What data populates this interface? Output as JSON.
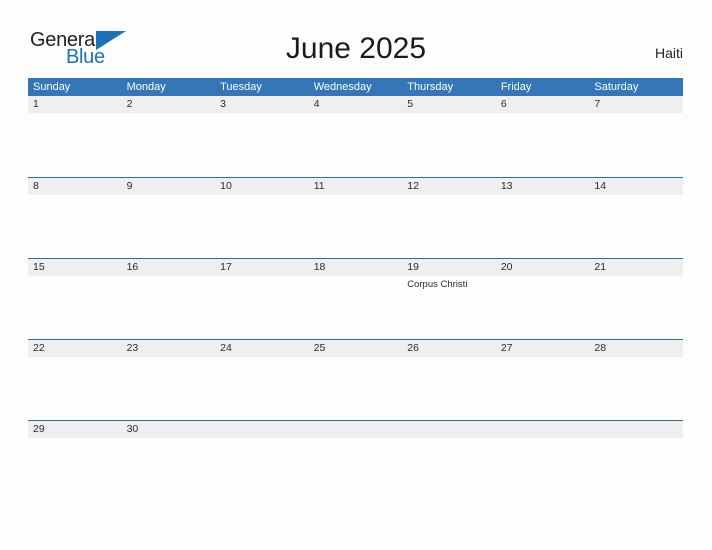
{
  "header": {
    "logo": {
      "general": "General",
      "blue": "Blue",
      "flag_icon": "triangle-flag-icon"
    },
    "title": "June 2025",
    "country": "Haiti"
  },
  "colors": {
    "header_blue": "#3576b9",
    "row_border_blue": "#2a6db3",
    "date_band_gray": "#efefef",
    "logo_blue": "#1c72b8",
    "page_background": "#fdfdfd",
    "text_dark": "#2b2b2b"
  },
  "calendar": {
    "weekdays": [
      "Sunday",
      "Monday",
      "Tuesday",
      "Wednesday",
      "Thursday",
      "Friday",
      "Saturday"
    ],
    "weeks": [
      [
        {
          "date": "1",
          "events": []
        },
        {
          "date": "2",
          "events": []
        },
        {
          "date": "3",
          "events": []
        },
        {
          "date": "4",
          "events": []
        },
        {
          "date": "5",
          "events": []
        },
        {
          "date": "6",
          "events": []
        },
        {
          "date": "7",
          "events": []
        }
      ],
      [
        {
          "date": "8",
          "events": []
        },
        {
          "date": "9",
          "events": []
        },
        {
          "date": "10",
          "events": []
        },
        {
          "date": "11",
          "events": []
        },
        {
          "date": "12",
          "events": []
        },
        {
          "date": "13",
          "events": []
        },
        {
          "date": "14",
          "events": []
        }
      ],
      [
        {
          "date": "15",
          "events": []
        },
        {
          "date": "16",
          "events": []
        },
        {
          "date": "17",
          "events": []
        },
        {
          "date": "18",
          "events": []
        },
        {
          "date": "19",
          "events": [
            "Corpus Christi"
          ]
        },
        {
          "date": "20",
          "events": []
        },
        {
          "date": "21",
          "events": []
        }
      ],
      [
        {
          "date": "22",
          "events": []
        },
        {
          "date": "23",
          "events": []
        },
        {
          "date": "24",
          "events": []
        },
        {
          "date": "25",
          "events": []
        },
        {
          "date": "26",
          "events": []
        },
        {
          "date": "27",
          "events": []
        },
        {
          "date": "28",
          "events": []
        }
      ],
      [
        {
          "date": "29",
          "events": []
        },
        {
          "date": "30",
          "events": []
        },
        {
          "date": "",
          "events": []
        },
        {
          "date": "",
          "events": []
        },
        {
          "date": "",
          "events": []
        },
        {
          "date": "",
          "events": []
        },
        {
          "date": "",
          "events": []
        }
      ]
    ]
  }
}
